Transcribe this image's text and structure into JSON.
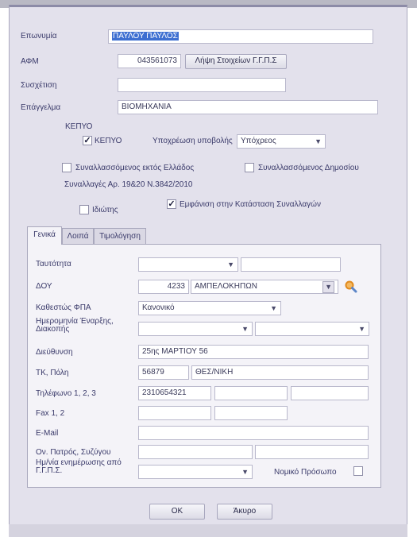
{
  "header": {
    "name_label": "Επωνυμία",
    "name_value": "ΠΑΥΛΟΥ ΠΑΥΛΟΣ",
    "afm_label": "ΑΦΜ",
    "afm_value": "043561073",
    "fetch_button": "Λήψη Στοιχείων Γ.Γ.Π.Σ",
    "relation_label": "Συσχέτιση",
    "relation_value": "",
    "profession_label": "Επάγγελμα",
    "profession_value": "ΒΙΟΜΗΧΑΝΙΑ"
  },
  "kepyo": {
    "group_label": "ΚΕΠΥΟ",
    "checkbox_label": "ΚΕΠΥΟ",
    "checked": true,
    "obligation_label": "Υποχρέωση υποβολής",
    "obligation_value": "Υπόχρεος"
  },
  "options": {
    "abroad_label": "Συναλλασσόμενος εκτός Ελλάδος",
    "abroad_checked": false,
    "public_label": "Συναλλασσόμενος Δημοσίου",
    "public_checked": false,
    "law_text": "Συναλλαγές Αρ. 19&20 Ν.3842/2010",
    "individual_label": "Ιδιώτης",
    "individual_checked": false,
    "show_label": "Εμφάνιση στην Κατάσταση Συναλλαγών",
    "show_checked": true
  },
  "tabs": [
    {
      "label": "Γενικά",
      "active": true
    },
    {
      "label": "Λοιπά",
      "active": false
    },
    {
      "label": "Τιμολόγηση",
      "active": false
    }
  ],
  "general": {
    "identity_label": "Ταυτότητα",
    "identity_type": "",
    "identity_value": "",
    "doy_label": "ΔΟΥ",
    "doy_code": "4233",
    "doy_name": "ΑΜΠΕΛΟΚΗΠΩΝ",
    "vat_label": "Καθεστώς ΦΠΑ",
    "vat_value": "Κανονικό",
    "dates_label": "Ημερομηνία Έναρξης, Διακοπής",
    "start_date": "",
    "stop_date": "",
    "address_label": "Διεύθυνση",
    "address_value": "25ης ΜΑΡΤΙΟΥ 56",
    "zip_city_label": "ΤΚ, Πόλη",
    "zip_value": "56879",
    "city_value": "ΘΕΣ/ΝΙΚΗ",
    "phone_label": "Τηλέφωνο 1, 2, 3",
    "phone1": "2310654321",
    "phone2": "",
    "phone3": "",
    "fax_label": "Fax 1, 2",
    "fax1": "",
    "fax2": "",
    "email_label": "E-Mail",
    "email_value": "",
    "father_label": "Ον. Πατρός, Συζύγου",
    "father_value": "",
    "spouse_value": "",
    "update_date_label": "Ημ/νία ενημέρωσης από Γ.Γ.Π.Σ.",
    "update_date_value": "",
    "legal_entity_label": "Νομικό Πρόσωπο",
    "legal_entity_checked": false
  },
  "footer": {
    "ok_label": "ΟΚ",
    "cancel_label": "Άκυρο"
  },
  "icons": {
    "dropdown": "chevron-down-icon",
    "search": "magnifier-icon",
    "check": "checkmark-icon"
  },
  "colors": {
    "window_bg": "#e3e1ec",
    "panel_bg": "#f4f3f8",
    "selection": "#3d6fd1",
    "search_icon": "#e08a1e"
  }
}
